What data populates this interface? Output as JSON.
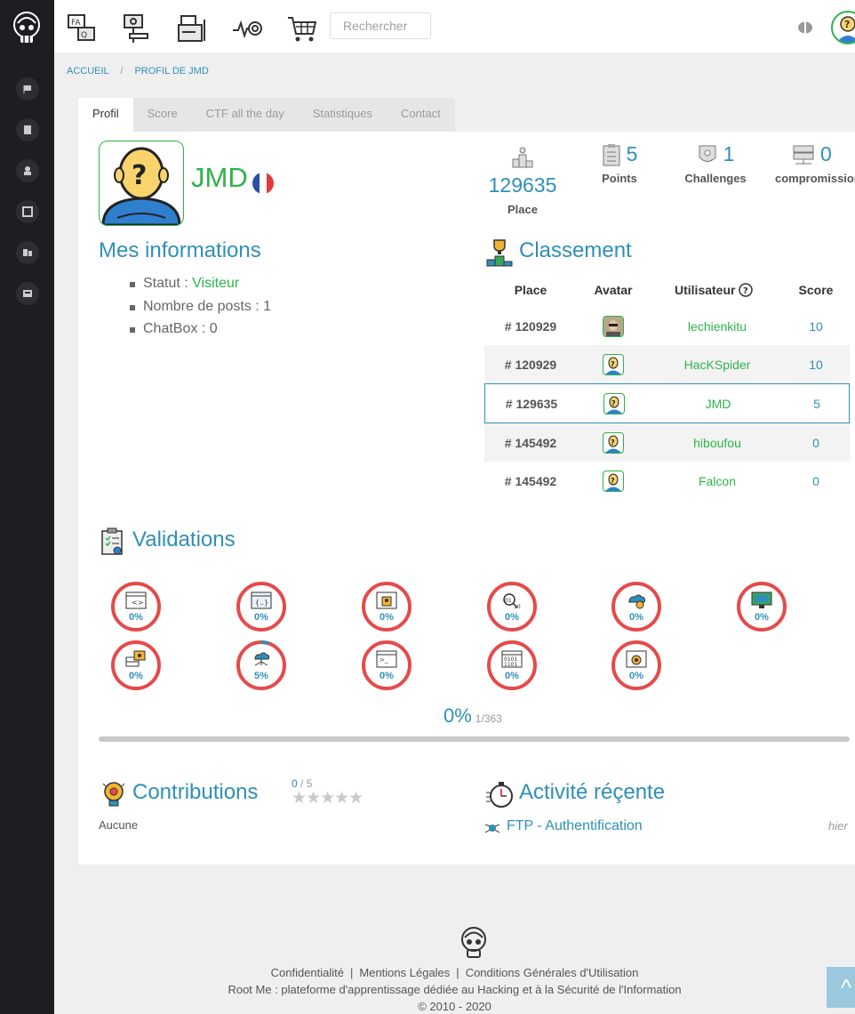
{
  "colors": {
    "accent": "#2f8fb8",
    "green": "#2db34a",
    "red": "#e54a4a",
    "sidebar": "#1c1e22"
  },
  "topbar": {
    "icons": [
      "faq-icon",
      "network-icon",
      "documents-icon",
      "heartbeat-target-icon",
      "shopping-cart-icon"
    ],
    "search_placeholder": "Rechercher"
  },
  "breadcrumb": {
    "home": "ACCUEIL",
    "separator": "/",
    "current": "PROFIL DE JMD"
  },
  "tabs": [
    "Profil",
    "Score",
    "CTF all the day",
    "Statistiques",
    "Contact"
  ],
  "active_tab": "Profil",
  "profile": {
    "name": "JMD",
    "country": "France",
    "stats": {
      "place": {
        "value": "129635",
        "label": "Place"
      },
      "points": {
        "value": "5",
        "label": "Points"
      },
      "challenges": {
        "value": "1",
        "label": "Challenges"
      },
      "compromissions": {
        "value": "0",
        "label": "compromissions"
      }
    }
  },
  "infos": {
    "title": "Mes informations",
    "statut_label": "Statut :",
    "statut_value": "Visiteur",
    "posts": "Nombre de posts : 1",
    "chatbox": "ChatBox : 0"
  },
  "classement": {
    "title": "Classement",
    "headers": {
      "place": "Place",
      "avatar": "Avatar",
      "user": "Utilisateur",
      "score": "Score"
    },
    "rows": [
      {
        "place": "# 120929",
        "user": "lechienkitu",
        "score": "10",
        "avatar": "photo"
      },
      {
        "place": "# 120929",
        "user": "HacKSpider",
        "score": "10",
        "avatar": "default"
      },
      {
        "place": "# 129635",
        "user": "JMD",
        "score": "5",
        "avatar": "default"
      },
      {
        "place": "# 145492",
        "user": "hiboufou",
        "score": "0",
        "avatar": "default"
      },
      {
        "place": "# 145492",
        "user": "Falcon",
        "score": "0",
        "avatar": "default"
      }
    ]
  },
  "validations": {
    "title": "Validations",
    "categories": [
      {
        "icon": "code-window-icon",
        "percent": 0
      },
      {
        "icon": "braces-window-icon",
        "percent": 0
      },
      {
        "icon": "keyhole-window-icon",
        "percent": 0
      },
      {
        "icon": "binary-magnifier-icon",
        "percent": 0
      },
      {
        "icon": "cloud-globe-icon",
        "percent": 0
      },
      {
        "icon": "monitor-network-icon",
        "percent": 0
      },
      {
        "icon": "server-gear-icon",
        "percent": 0
      },
      {
        "icon": "cloud-network-icon",
        "percent": 5
      },
      {
        "icon": "terminal-icon",
        "percent": 0
      },
      {
        "icon": "binary-window-icon",
        "percent": 0
      },
      {
        "icon": "bug-magnifier-icon",
        "percent": 0
      }
    ],
    "total_percent": "0%",
    "total_count": "1/363"
  },
  "contributions": {
    "title": "Contributions",
    "rating": "0",
    "rating_max": "/ 5",
    "none": "Aucune"
  },
  "activite": {
    "title": "Activité réçente",
    "item": "FTP - Authentification",
    "time": "hier"
  },
  "footer": {
    "links": [
      "Confidentialité",
      "Mentions Légales",
      "Conditions Générales d'Utilisation"
    ],
    "separator": "|",
    "description": "Root Me : plateforme d'apprentissage dédiée au Hacking et à la Sécurité de l'Information",
    "copyright": "© 2010 - 2020",
    "back_top": "^"
  }
}
